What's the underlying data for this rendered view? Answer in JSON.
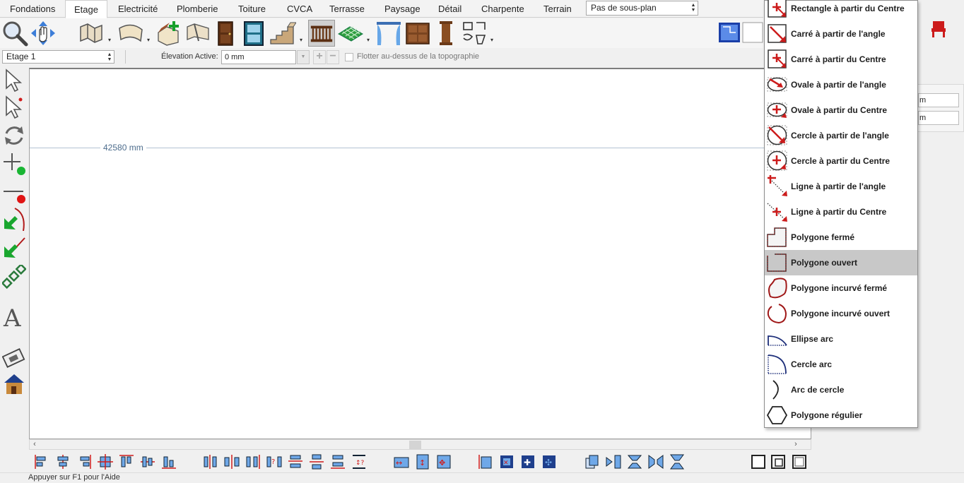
{
  "tabs": [
    {
      "label": "Fondations",
      "active": false
    },
    {
      "label": "Etage",
      "active": true
    },
    {
      "label": "Electricité",
      "active": false
    },
    {
      "label": "Plomberie",
      "active": false
    },
    {
      "label": "Toiture",
      "active": false
    },
    {
      "label": "CVCA",
      "active": false
    },
    {
      "label": "Terrasse",
      "active": false
    },
    {
      "label": "Paysage",
      "active": false
    },
    {
      "label": "Détail",
      "active": false
    },
    {
      "label": "Charpente",
      "active": false
    },
    {
      "label": "Terrain",
      "active": false
    }
  ],
  "subplan": {
    "value": "Pas de sous-plan"
  },
  "options": {
    "floor": "Etage 1",
    "elevation_label": "Élevation Active:",
    "elevation_value": "0 mm",
    "float_label": "Flotter au-dessus de la topographie",
    "float_checked": false
  },
  "canvas": {
    "dimension": "42580 mm"
  },
  "right_fields": [
    {
      "value": "m"
    },
    {
      "value": "m"
    }
  ],
  "status": {
    "text": "Appuyer sur F1 pour l'Aide"
  },
  "menu": {
    "items": [
      {
        "label": "Rectangle à partir du Centre",
        "icon": "rectangle-center-icon"
      },
      {
        "label": "Carré à partir de l'angle",
        "icon": "square-corner-icon"
      },
      {
        "label": "Carré à partir du Centre",
        "icon": "square-center-icon"
      },
      {
        "label": "Ovale à partir de l'angle",
        "icon": "oval-corner-icon"
      },
      {
        "label": "Ovale à partir du Centre",
        "icon": "oval-center-icon"
      },
      {
        "label": "Cercle à partir de l'angle",
        "icon": "circle-corner-icon"
      },
      {
        "label": "Cercle à partir du Centre",
        "icon": "circle-center-icon"
      },
      {
        "label": "Ligne à partir de l'angle",
        "icon": "line-corner-icon"
      },
      {
        "label": "Ligne à partir du Centre",
        "icon": "line-center-icon"
      },
      {
        "label": "Polygone fermé",
        "icon": "closed-polygon-icon"
      },
      {
        "label": "Polygone ouvert",
        "icon": "open-polygon-icon",
        "highlighted": true
      },
      {
        "label": "Polygone incurvé fermé",
        "icon": "closed-curved-polygon-icon"
      },
      {
        "label": "Polygone incurvé ouvert",
        "icon": "open-curved-polygon-icon"
      },
      {
        "label": "Ellipse arc",
        "icon": "ellipse-arc-icon"
      },
      {
        "label": "Cercle arc",
        "icon": "circle-arc-icon"
      },
      {
        "label": "Arc de cercle",
        "icon": "arc-icon"
      },
      {
        "label": "Polygone régulier",
        "icon": "regular-polygon-icon"
      }
    ]
  },
  "colors": {
    "accent_red": "#cc1b1b",
    "accent_blue": "#1e4fbf",
    "dimension_blue": "#4e6d8d",
    "highlight": "#c8c8c8"
  }
}
